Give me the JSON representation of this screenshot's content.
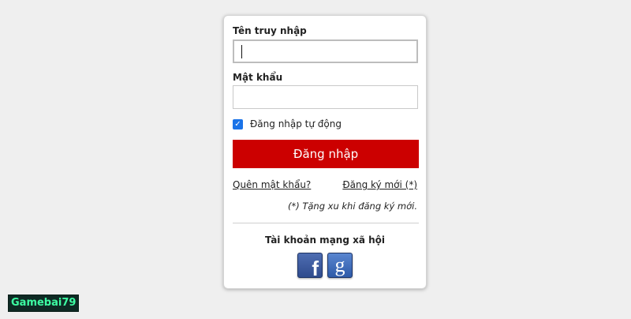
{
  "login_form": {
    "username_label": "Tên truy nhập",
    "username_value": "",
    "password_label": "Mật khẩu",
    "password_value": "",
    "remember_checked": true,
    "remember_label": "Đăng nhập tự động",
    "login_button_label": "Đăng nhập",
    "forgot_password_link": "Quên mật khẩu?",
    "register_link": "Đăng ký mới (*)",
    "register_note": "(*) Tặng xu khi đăng ký mới.",
    "social_title": "Tài khoản mạng xã hội",
    "social_buttons": [
      {
        "icon": "facebook-icon",
        "glyph": "f"
      },
      {
        "icon": "google-icon",
        "glyph": "g"
      }
    ]
  },
  "watermark": {
    "text": "Gamebai79"
  },
  "colors": {
    "login_button": "#cc0000",
    "checkbox": "#1a73e8",
    "watermark_text": "#3dffa3",
    "watermark_bg": "#0e2a24",
    "background": "#efefef"
  }
}
